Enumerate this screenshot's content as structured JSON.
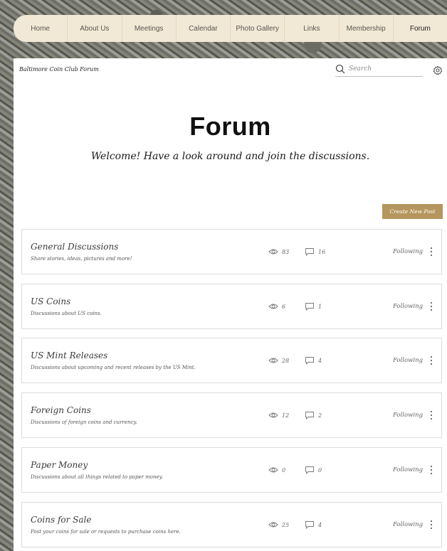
{
  "nav": {
    "items": [
      {
        "label": "Home"
      },
      {
        "label": "About Us"
      },
      {
        "label": "Meetings"
      },
      {
        "label": "Calendar"
      },
      {
        "label": "Photo Gallery"
      },
      {
        "label": "Links"
      },
      {
        "label": "Membership"
      },
      {
        "label": "Forum"
      }
    ],
    "active": "Forum"
  },
  "header": {
    "breadcrumb": "Baltimore Coin Club Forum",
    "search_placeholder": "Search"
  },
  "hero": {
    "title": "Forum",
    "subtitle": "Welcome! Have a look around and join the discussions."
  },
  "create_post_label": "Create New Post",
  "categories": [
    {
      "title": "General Discussions",
      "description": "Share stories, ideas, pictures and more!",
      "views": "83",
      "comments": "16",
      "follow_label": "Following"
    },
    {
      "title": "US Coins",
      "description": "Discussions about US coins.",
      "views": "6",
      "comments": "1",
      "follow_label": "Following"
    },
    {
      "title": "US Mint Releases",
      "description": "Discussions about upcoming and recent releases by the US Mint.",
      "views": "28",
      "comments": "4",
      "follow_label": "Following"
    },
    {
      "title": "Foreign Coins",
      "description": "Discussions of foreign coins and currency.",
      "views": "12",
      "comments": "2",
      "follow_label": "Following"
    },
    {
      "title": "Paper Money",
      "description": "Discussions about all things related to paper money.",
      "views": "0",
      "comments": "0",
      "follow_label": "Following"
    },
    {
      "title": "Coins for Sale",
      "description": "Post your coins for sale or requests to purchase coins here.",
      "views": "25",
      "comments": "4",
      "follow_label": "Following"
    }
  ],
  "colors": {
    "nav_background": "#f1e8d6",
    "accent_button": "#b5965c"
  }
}
